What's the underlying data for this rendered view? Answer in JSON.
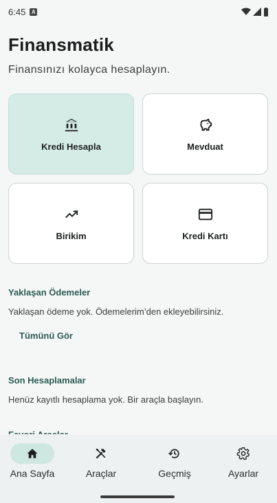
{
  "status": {
    "time": "6:45",
    "notif_glyph": "A"
  },
  "header": {
    "title": "Finansmatik",
    "subtitle": "Finansınızı kolayca hesaplayın."
  },
  "cards": [
    {
      "label": "Kredi Hesapla",
      "icon": "bank-icon",
      "active": true
    },
    {
      "label": "Mevduat",
      "icon": "piggy-bank-icon",
      "active": false
    },
    {
      "label": "Birikim",
      "icon": "trending-up-icon",
      "active": false
    },
    {
      "label": "Kredi Kartı",
      "icon": "credit-card-icon",
      "active": false
    }
  ],
  "upcoming": {
    "title": "Yaklaşan Ödemeler",
    "empty_text": "Yaklaşan ödeme yok. Ödemelerim’den ekleyebilirsiniz.",
    "see_all": "Tümünü Gör"
  },
  "recent": {
    "title": "Son Hesaplamalar",
    "empty_text": "Henüz kayıtlı hesaplama yok. Bir araçla başlayın."
  },
  "favorites": {
    "title": "Favori Araçlar"
  },
  "nav": [
    {
      "label": "Ana Sayfa",
      "icon": "home-icon",
      "active": true
    },
    {
      "label": "Araçlar",
      "icon": "tools-icon",
      "active": false
    },
    {
      "label": "Geçmiş",
      "icon": "history-icon",
      "active": false
    },
    {
      "label": "Ayarlar",
      "icon": "gear-icon",
      "active": false
    }
  ],
  "colors": {
    "accent": "#2b5c53",
    "active_card": "#d5ebe6",
    "active_pill": "#cfe7e1"
  }
}
